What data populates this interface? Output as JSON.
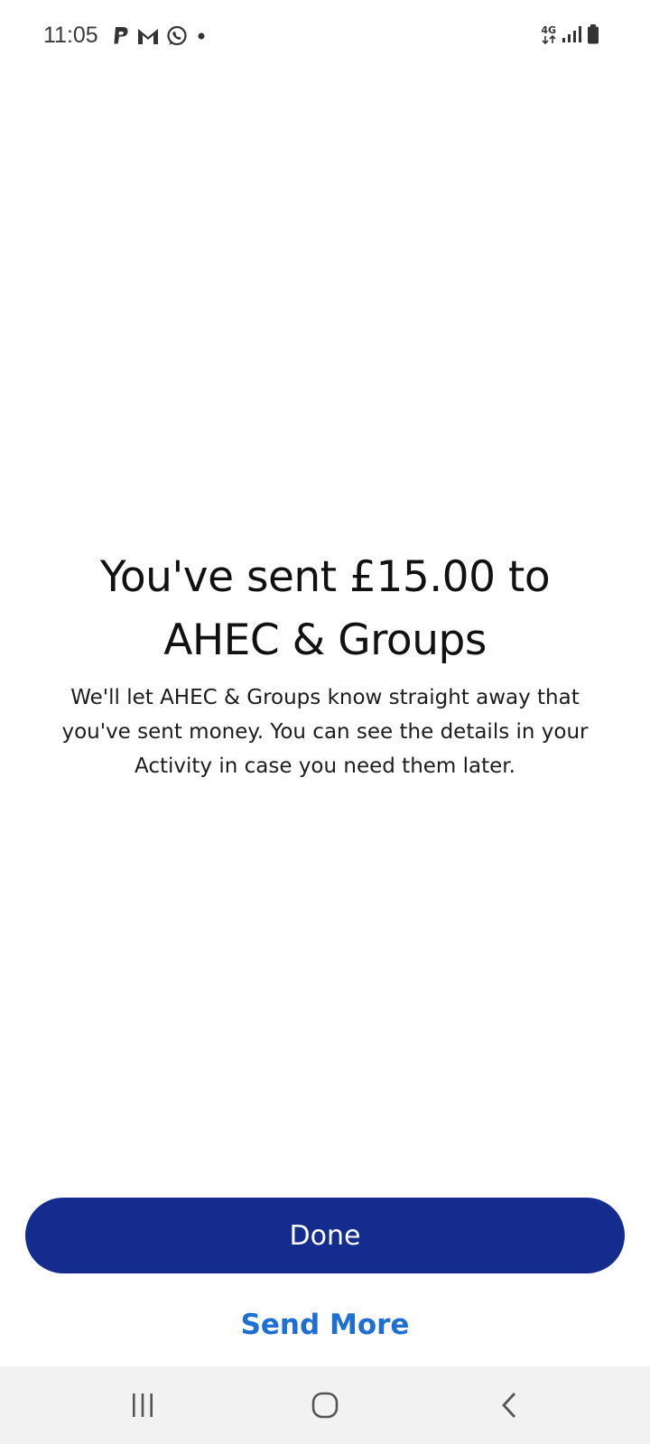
{
  "status_bar": {
    "time": "11:05",
    "left_icons": [
      "paypal-icon",
      "gmail-icon",
      "whatsapp-icon",
      "dot-icon"
    ],
    "network_label": "4G",
    "right_icons": [
      "network-4g-icon",
      "signal-icon",
      "battery-icon"
    ]
  },
  "confirmation": {
    "headline_line1": "You've sent £15.00 to",
    "headline_line2": "AHEC & Groups",
    "message_line1": "We'll let AHEC & Groups know straight away that",
    "message_line2": "you've sent money. You can see the details in your",
    "message_line3": "Activity in case you need them later."
  },
  "actions": {
    "done_label": "Done",
    "send_more_label": "Send More"
  },
  "navigation": {
    "icons": [
      "recents-icon",
      "home-icon",
      "back-icon"
    ]
  },
  "colors": {
    "primary_button": "#142c8e",
    "link": "#1d6fd6",
    "text": "#111111",
    "nav_background": "#f2f2f2"
  }
}
